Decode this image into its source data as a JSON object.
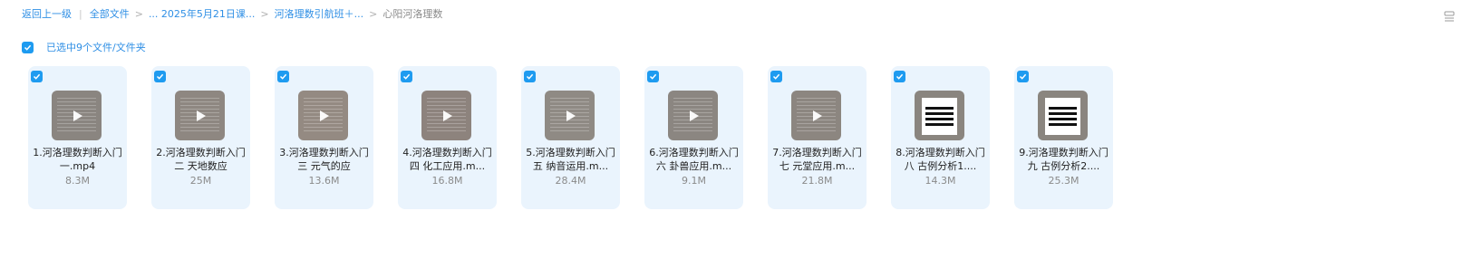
{
  "breadcrumb": {
    "back": "返回上一级",
    "all_files": "全部文件",
    "crumb1": "... 2025年5月21日课...",
    "crumb2": "河洛理数引航班＋...",
    "current": "心阳河洛理数"
  },
  "selection": {
    "label": "已选中9个文件/文件夹"
  },
  "files": [
    {
      "name": "1.河洛理数判断入门一.mp4",
      "size": "8.3M",
      "thumb": "video",
      "bg": "#8a8580"
    },
    {
      "name": "2.河洛理数判断入门二 天地数应",
      "size": "25M",
      "thumb": "video",
      "bg": "#8e8781"
    },
    {
      "name": "3.河洛理数判断入门三 元气的应",
      "size": "13.6M",
      "thumb": "video-doc",
      "bg": "#948a82"
    },
    {
      "name": "4.河洛理数判断入门四 化工应用.m...",
      "size": "16.8M",
      "thumb": "video",
      "bg": "#8d837d"
    },
    {
      "name": "5.河洛理数判断入门五 纳音运用.m...",
      "size": "28.4M",
      "thumb": "video",
      "bg": "#8f8a84"
    },
    {
      "name": "6.河洛理数判断入门六 卦兽应用.m...",
      "size": "9.1M",
      "thumb": "video",
      "bg": "#8b8681"
    },
    {
      "name": "7.河洛理数判断入门七 元堂应用.m...",
      "size": "21.8M",
      "thumb": "video",
      "bg": "#8c8680"
    },
    {
      "name": "8.河洛理数判断入门八 古例分析1....",
      "size": "14.3M",
      "thumb": "gua",
      "bg": "#8a857f"
    },
    {
      "name": "9.河洛理数判断入门九 古例分析2....",
      "size": "25.3M",
      "thumb": "gua",
      "bg": "#8a857f"
    }
  ],
  "colors": {
    "accent": "#1e9bf0",
    "card_bg": "#eaf4fd",
    "link": "#2f8fe5"
  }
}
